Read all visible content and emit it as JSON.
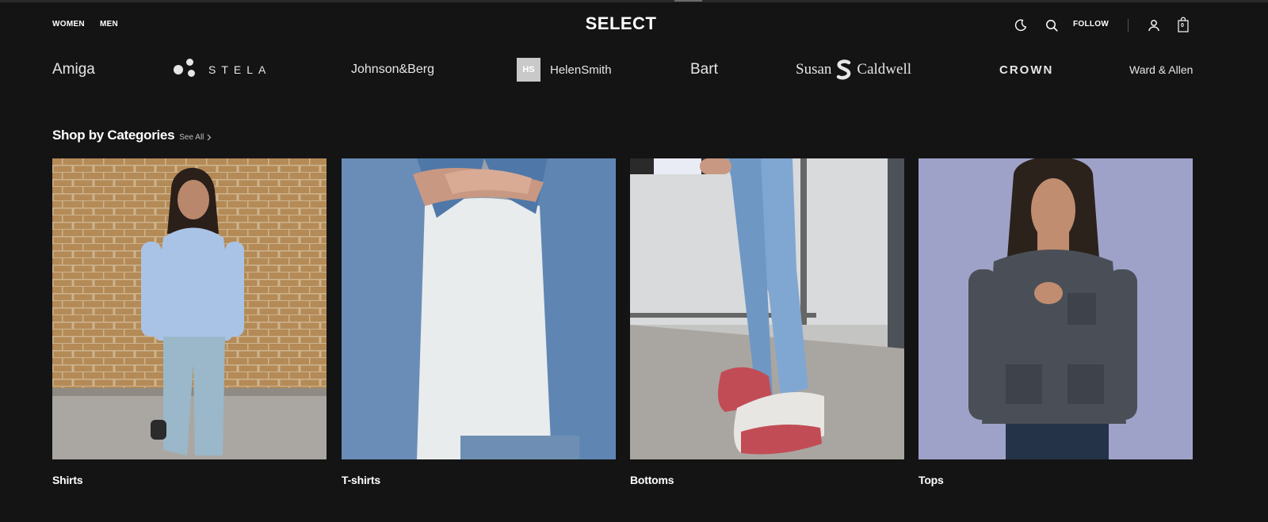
{
  "header": {
    "nav": [
      "WOMEN",
      "MEN"
    ],
    "logo": "SELECT",
    "follow_label": "FOLLOW",
    "cart_count": "0",
    "icons": [
      "moon-icon",
      "search-icon",
      "user-icon",
      "bag-icon"
    ]
  },
  "brands": [
    "Amiga",
    "STELA",
    "Johnson&Berg",
    "HelenSmith",
    "Bart",
    "Susan",
    "Caldwell",
    "CROWN",
    "Ward & Allen"
  ],
  "brand_badges": {
    "helen": "HS"
  },
  "categories_section": {
    "title": "Shop by Categories",
    "see_all": "See All",
    "items": [
      {
        "label": "Shirts"
      },
      {
        "label": "T-shirts"
      },
      {
        "label": "Bottoms"
      },
      {
        "label": "Tops"
      }
    ]
  },
  "colors": {
    "background": "#141414",
    "text": "#ffffff",
    "muted": "#bdbdbd"
  }
}
